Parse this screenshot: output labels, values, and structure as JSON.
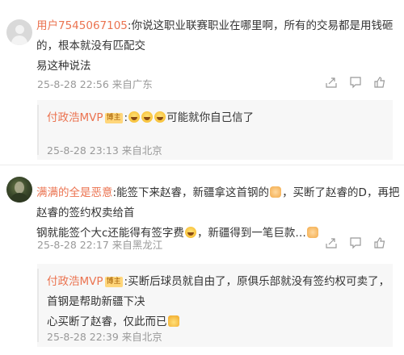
{
  "comments": [
    {
      "username": "用户7545067105",
      "text_line1": ":你说这职业联赛职业在哪里啊，所有的交易都是用钱砸的，根本就没有匹配交",
      "text_line2": "易这种说法",
      "timestamp": "25-8-28 22:56",
      "location": "来自广东",
      "icons": [
        "share-icon",
        "comment-icon",
        "like-icon"
      ],
      "reply": {
        "username": "付政浩MVP",
        "badge": "博主",
        "text": "可能就你自己信了",
        "emojis": [
          "laugh",
          "laugh",
          "laugh"
        ],
        "timestamp": "25-8-28 23:13",
        "location": "来自北京"
      }
    },
    {
      "username": "满满的全是恶意",
      "text_line1": ":能签下来赵睿，新疆拿这首钢的",
      "text_line1b": "，买断了赵睿的D，再把赵睿的签约权卖给首",
      "text_line2": "钢就能签个大c还能得有签字费",
      "text_line2b": "，新疆得到一笔巨款…",
      "timestamp": "25-8-28 22:17",
      "location": "来自黑龙江",
      "icons": [
        "share-icon",
        "comment-icon",
        "like-icon"
      ],
      "reply": {
        "username": "付政浩MVP",
        "badge": "博主",
        "text_line1": ":买断后球员就自由了，原俱乐部就没有签约权可卖了，首钢是帮助新疆下决",
        "text_line2": "心买断了赵睿，仅此而已",
        "timestamp": "25-8-28 22:39",
        "location": "来自北京"
      }
    }
  ]
}
